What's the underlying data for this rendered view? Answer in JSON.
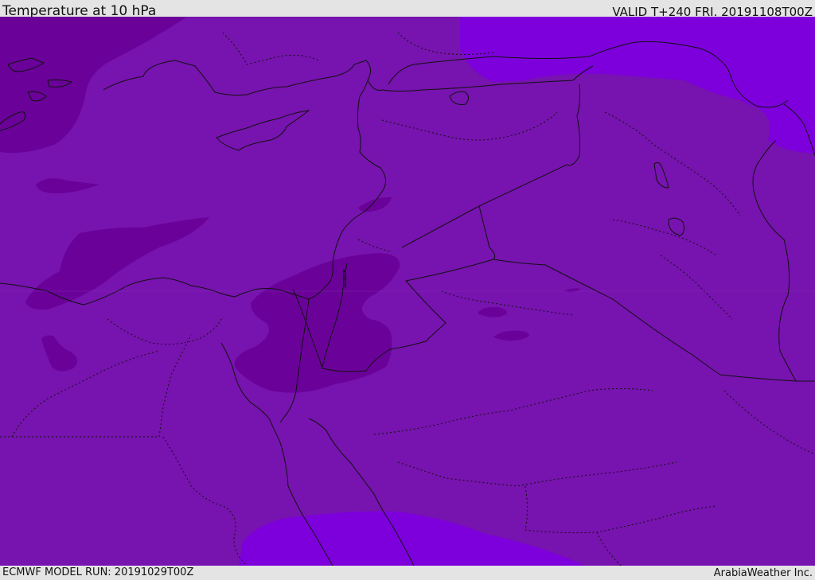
{
  "header": {
    "title": "Temperature at 10 hPa",
    "valid": "VALID T+240 FRI. 20191108T00Z"
  },
  "footer": {
    "model_run": "ECMWF MODEL RUN: 20191029T00Z",
    "credit": "ArabiaWeather Inc."
  },
  "map": {
    "colors": {
      "base": "#7713ae",
      "cold": "#6a0299",
      "warm": "#7d00dc"
    }
  }
}
